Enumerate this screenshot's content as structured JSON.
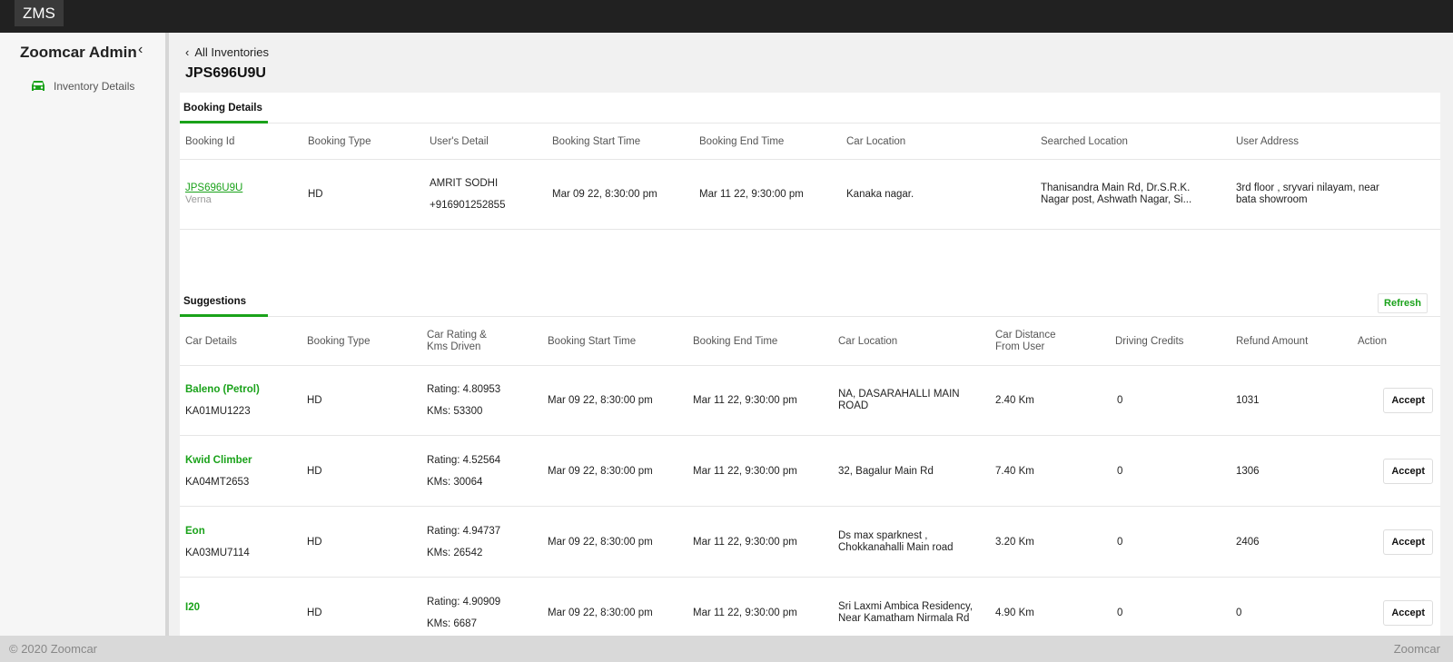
{
  "app": {
    "logo": "ZMS",
    "sidebar_title": "Zoomcar Admin"
  },
  "sidebar": {
    "items": [
      {
        "label": "Inventory Details",
        "icon": "car-icon"
      }
    ]
  },
  "header": {
    "back_label": "All Inventories",
    "title": "JPS696U9U"
  },
  "booking": {
    "tab": "Booking Details",
    "columns": [
      "Booking Id",
      "Booking Type",
      "User's Detail",
      "Booking Start Time",
      "Booking End Time",
      "Car Location",
      "Searched Location",
      "User Address"
    ],
    "row": {
      "id": "JPS696U9U",
      "car": "Verna",
      "type": "HD",
      "user_name": "AMRIT SODHI",
      "user_phone": "+916901252855",
      "start": "Mar 09 22, 8:30:00 pm",
      "end": "Mar 11 22, 9:30:00 pm",
      "car_location": "Kanaka nagar.",
      "searched_1": "Thanisandra Main Rd, Dr.S.R.K.",
      "searched_2": "Nagar post, Ashwath Nagar, Si...",
      "address_1": "3rd floor , sryvari nilayam, near",
      "address_2": "bata showroom"
    }
  },
  "suggestions": {
    "tab": "Suggestions",
    "refresh": "Refresh",
    "columns": {
      "car": "Car Details",
      "type": "Booking Type",
      "rating_1": "Car Rating &",
      "rating_2": "Kms Driven",
      "start": "Booking Start Time",
      "end": "Booking End Time",
      "location": "Car Location",
      "distance_1": "Car Distance",
      "distance_2": "From User",
      "credits": "Driving Credits",
      "refund": "Refund Amount",
      "action": "Action"
    },
    "rows": [
      {
        "name": "Baleno (Petrol)",
        "plate": "KA01MU1223",
        "type": "HD",
        "rating": "Rating: 4.80953",
        "kms": "KMs: 53300",
        "start": "Mar 09 22, 8:30:00 pm",
        "end": "Mar 11 22, 9:30:00 pm",
        "loc_1": "NA, DASARAHALLI MAIN",
        "loc_2": "ROAD",
        "distance": "2.40 Km",
        "credits": "0",
        "refund": "1031",
        "action": "Accept"
      },
      {
        "name": "Kwid Climber",
        "plate": "KA04MT2653",
        "type": "HD",
        "rating": "Rating: 4.52564",
        "kms": "KMs: 30064",
        "start": "Mar 09 22, 8:30:00 pm",
        "end": "Mar 11 22, 9:30:00 pm",
        "loc_1": "32, Bagalur Main Rd",
        "loc_2": "",
        "distance": "7.40 Km",
        "credits": "0",
        "refund": "1306",
        "action": "Accept"
      },
      {
        "name": "Eon",
        "plate": "KA03MU7114",
        "type": "HD",
        "rating": "Rating: 4.94737",
        "kms": "KMs: 26542",
        "start": "Mar 09 22, 8:30:00 pm",
        "end": "Mar 11 22, 9:30:00 pm",
        "loc_1": "Ds max sparknest ,",
        "loc_2": "Chokkanahalli Main road",
        "distance": "3.20 Km",
        "credits": "0",
        "refund": "2406",
        "action": "Accept"
      },
      {
        "name": "I20",
        "plate": "",
        "type": "HD",
        "rating": "Rating: 4.90909",
        "kms": "KMs: 6687",
        "start": "Mar 09 22, 8:30:00 pm",
        "end": "Mar 11 22, 9:30:00 pm",
        "loc_1": "Sri Laxmi Ambica Residency,",
        "loc_2": "Near Kamatham Nirmala Rd",
        "distance": "4.90 Km",
        "credits": "0",
        "refund": "0",
        "action": "Accept"
      }
    ]
  },
  "footer": {
    "copyright": "© 2020 Zoomcar",
    "brand": "Zoomcar"
  },
  "colors": {
    "accent": "#1aa21a",
    "topbar": "#212121"
  }
}
